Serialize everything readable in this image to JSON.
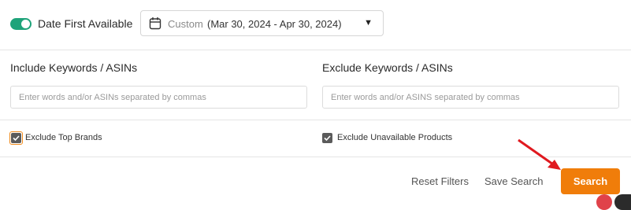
{
  "date_filter": {
    "toggle_label": "Date First Available",
    "toggle_on": true,
    "range_kind": "Custom",
    "range_value": "(Mar 30, 2024 - Apr 30, 2024)"
  },
  "include": {
    "label": "Include Keywords / ASINs",
    "placeholder": "Enter words and/or ASINs separated by commas",
    "value": ""
  },
  "exclude": {
    "label": "Exclude Keywords / ASINs",
    "placeholder": "Enter words and/or ASINS separated by commas",
    "value": ""
  },
  "options": {
    "exclude_top_brands": {
      "label": "Exclude Top Brands",
      "checked": true
    },
    "exclude_unavailable": {
      "label": "Exclude Unavailable Products",
      "checked": true
    }
  },
  "actions": {
    "reset_label": "Reset Filters",
    "save_label": "Save Search",
    "search_label": "Search"
  },
  "colors": {
    "toggle_on": "#1fa37a",
    "search_button": "#f07d0a",
    "focus_outline": "#f08a1a",
    "annotation_arrow": "#e0191f"
  }
}
